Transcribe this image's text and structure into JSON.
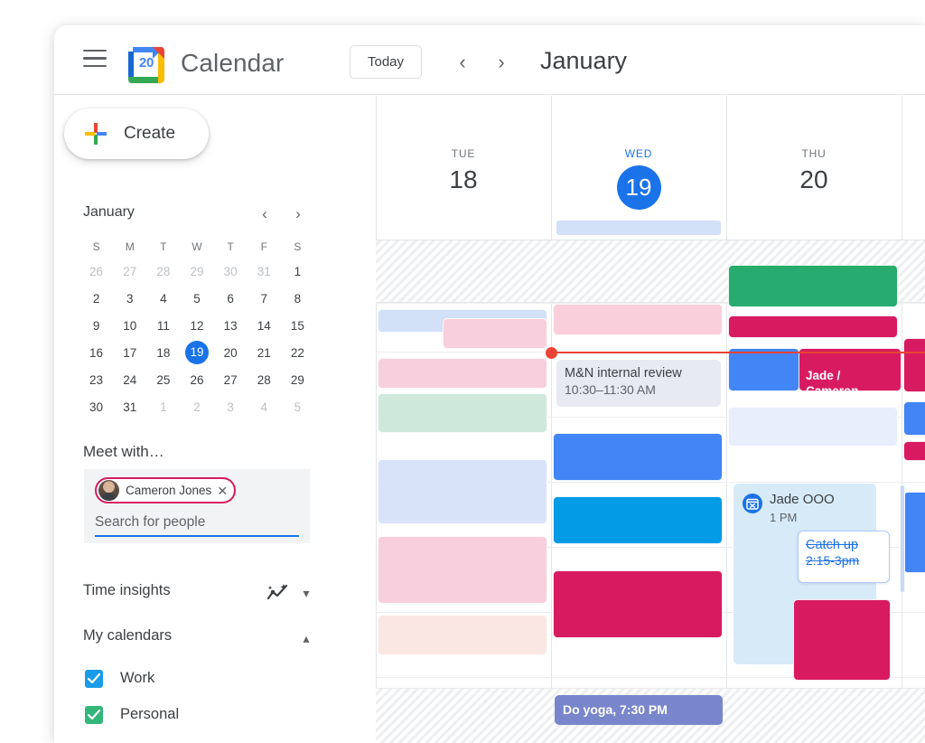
{
  "header": {
    "menu_icon": "hamburger-menu-icon",
    "app_icon": "google-calendar-icon",
    "app_icon_day": "20",
    "title": "Calendar",
    "today_label": "Today",
    "prev_icon": "chevron-left-icon",
    "next_icon": "chevron-right-icon",
    "period_title": "January"
  },
  "sidebar": {
    "create_label": "Create",
    "create_icon": "plus-icon",
    "mini_calendar": {
      "month": "January",
      "prev_icon": "chevron-left-icon",
      "next_icon": "chevron-right-icon",
      "weekday_headers": [
        "S",
        "M",
        "T",
        "W",
        "T",
        "F",
        "S"
      ],
      "weeks": [
        [
          {
            "d": "26",
            "muted": true
          },
          {
            "d": "27",
            "muted": true
          },
          {
            "d": "28",
            "muted": true
          },
          {
            "d": "29",
            "muted": true
          },
          {
            "d": "30",
            "muted": true
          },
          {
            "d": "31",
            "muted": true
          },
          {
            "d": "1",
            "muted": false
          }
        ],
        [
          {
            "d": "2",
            "muted": false
          },
          {
            "d": "3",
            "muted": false
          },
          {
            "d": "4",
            "muted": false
          },
          {
            "d": "5",
            "muted": false
          },
          {
            "d": "6",
            "muted": false
          },
          {
            "d": "7",
            "muted": false
          },
          {
            "d": "8",
            "muted": false
          }
        ],
        [
          {
            "d": "9",
            "muted": false
          },
          {
            "d": "10",
            "muted": false
          },
          {
            "d": "11",
            "muted": false
          },
          {
            "d": "12",
            "muted": false
          },
          {
            "d": "13",
            "muted": false
          },
          {
            "d": "14",
            "muted": false
          },
          {
            "d": "15",
            "muted": false
          }
        ],
        [
          {
            "d": "16",
            "muted": false
          },
          {
            "d": "17",
            "muted": false
          },
          {
            "d": "18",
            "muted": false
          },
          {
            "d": "19",
            "muted": false,
            "selected": true
          },
          {
            "d": "20",
            "muted": false
          },
          {
            "d": "21",
            "muted": false
          },
          {
            "d": "22",
            "muted": false
          }
        ],
        [
          {
            "d": "23",
            "muted": false
          },
          {
            "d": "24",
            "muted": false
          },
          {
            "d": "25",
            "muted": false
          },
          {
            "d": "26",
            "muted": false
          },
          {
            "d": "27",
            "muted": false
          },
          {
            "d": "28",
            "muted": false
          },
          {
            "d": "29",
            "muted": false
          }
        ],
        [
          {
            "d": "30",
            "muted": false
          },
          {
            "d": "31",
            "muted": false
          },
          {
            "d": "1",
            "muted": true
          },
          {
            "d": "2",
            "muted": true
          },
          {
            "d": "3",
            "muted": true
          },
          {
            "d": "4",
            "muted": true
          },
          {
            "d": "5",
            "muted": true
          }
        ]
      ]
    },
    "meet_with": {
      "title": "Meet with…",
      "chip_name": "Cameron Jones",
      "chip_avatar": "person-avatar",
      "chip_close_icon": "close-icon",
      "search_placeholder": "Search for people",
      "search_value": ""
    },
    "time_insights": {
      "label": "Time insights",
      "icon": "insights-chart-icon",
      "chevron": "chevron-down-icon"
    },
    "my_calendars": {
      "label": "My calendars",
      "chevron": "chevron-up-icon",
      "items": [
        {
          "label": "Work",
          "color": "#1a9be8",
          "checked": true
        },
        {
          "label": "Personal",
          "color": "#33b679",
          "checked": true
        }
      ]
    }
  },
  "calendar": {
    "days": [
      {
        "dow": "TUE",
        "num": "18",
        "today": false
      },
      {
        "dow": "WED",
        "num": "19",
        "today": true
      },
      {
        "dow": "THU",
        "num": "20",
        "today": false
      }
    ],
    "now_indicator": "current-time-line",
    "events": {
      "internal_review": {
        "title": "M&N internal review",
        "time": "10:30–11:30 AM"
      },
      "jade_cameron": {
        "title": "Jade /\nCameron"
      },
      "jade_ooo": {
        "title": "Jade OOO",
        "time": "1 PM",
        "icon": "out-of-office-icon"
      },
      "catch_up": {
        "title": "Catch up",
        "time": "2:15-3pm"
      },
      "do_yoga": {
        "title": "Do yoga, 7:30 PM"
      }
    },
    "colors": {
      "blue": "#4285f4",
      "cyan": "#039be5",
      "crimson": "#d81b60",
      "green": "#27ab6e",
      "indigo": "#7986cb",
      "today_blue": "#1a73e8"
    }
  }
}
